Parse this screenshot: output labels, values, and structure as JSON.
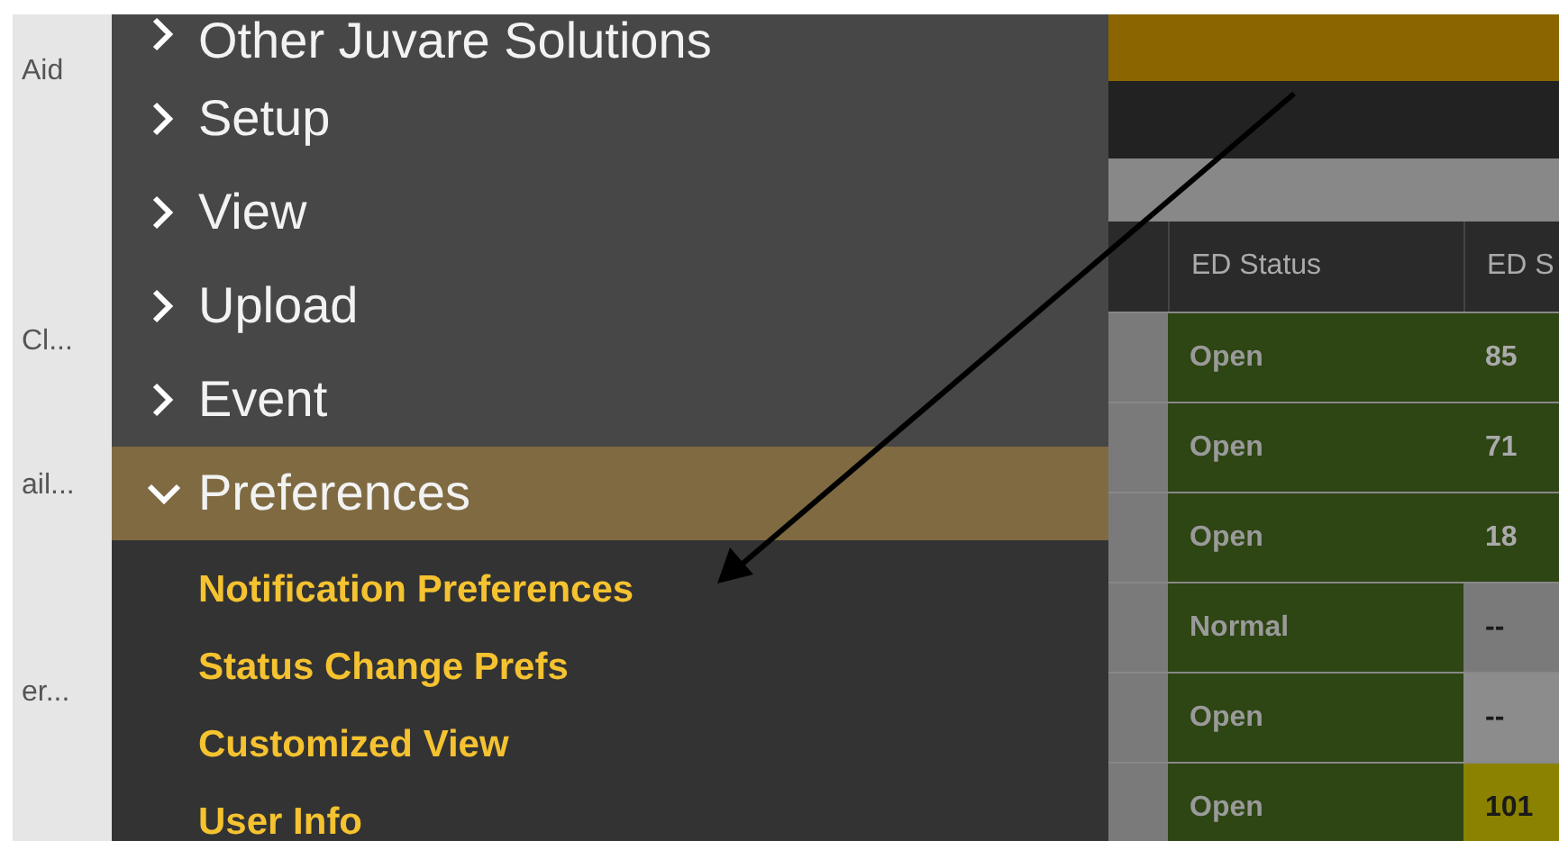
{
  "left_column": [
    "Aid",
    "Cl...",
    "ail...",
    "er..."
  ],
  "menu": {
    "items": [
      {
        "label": "Other Juvare Solutions",
        "expanded": false
      },
      {
        "label": "Setup",
        "expanded": false
      },
      {
        "label": "View",
        "expanded": false
      },
      {
        "label": "Upload",
        "expanded": false
      },
      {
        "label": "Event",
        "expanded": false
      },
      {
        "label": "Preferences",
        "expanded": true,
        "children": [
          "Notification Preferences",
          "Status Change Prefs",
          "Customized View",
          "User Info"
        ]
      }
    ]
  },
  "table": {
    "columns": [
      "ED Status",
      "ED S"
    ],
    "rows": [
      {
        "status": "Open",
        "score": "85",
        "color": "#2e4514"
      },
      {
        "status": "Open",
        "score": "71",
        "color": "#2e4514"
      },
      {
        "status": "Open",
        "score": "18",
        "color": "#2e4514"
      },
      {
        "status": "Normal",
        "score": "--",
        "color": "#7a7a7a"
      },
      {
        "status": "Open",
        "score": "--",
        "color": "#8c8c8c"
      },
      {
        "status": "Open",
        "score": "101",
        "color": "#8a8200"
      }
    ]
  }
}
